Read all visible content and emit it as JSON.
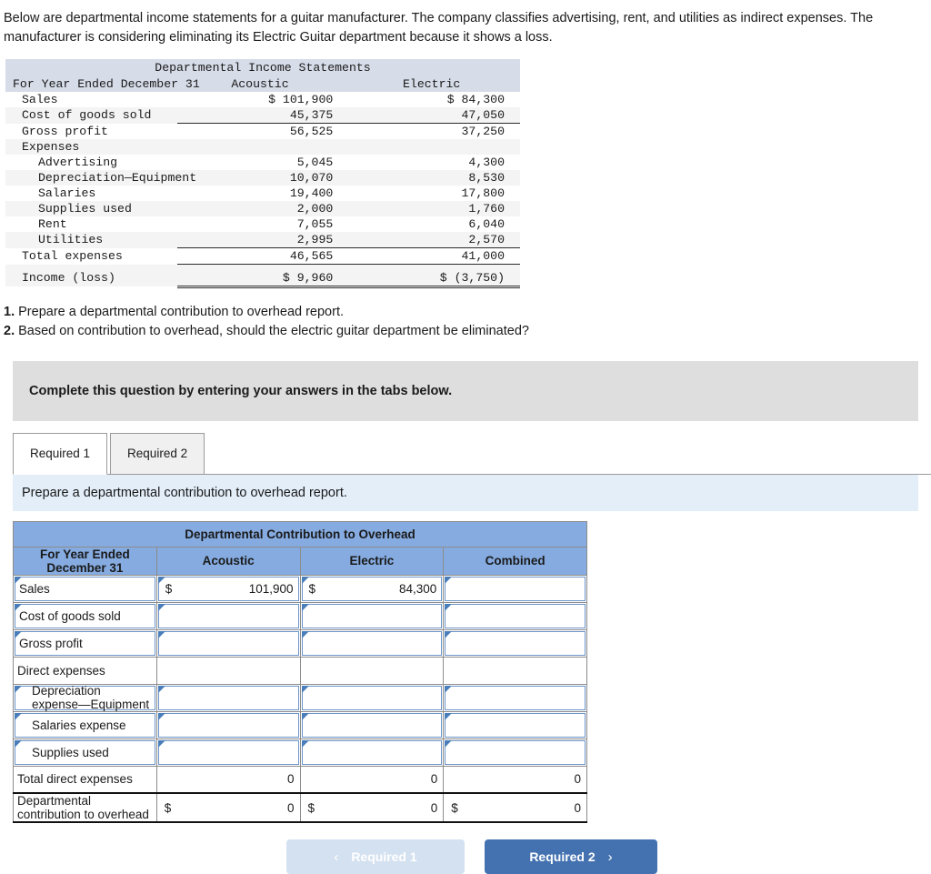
{
  "intro": "Below are departmental income statements for a guitar manufacturer. The company classifies advertising, rent, and utilities as indirect expenses. The manufacturer is considering eliminating its Electric Guitar department because it shows a loss.",
  "income_statement": {
    "title": "Departmental Income Statements",
    "period_label": "For Year Ended December 31",
    "columns": [
      "Acoustic",
      "Electric"
    ],
    "rows": [
      {
        "label": "Sales",
        "acoustic": "$ 101,900",
        "electric": "$ 84,300"
      },
      {
        "label": "Cost of goods sold",
        "acoustic": "45,375",
        "electric": "47,050"
      },
      {
        "label": "Gross profit",
        "acoustic": "56,525",
        "electric": "37,250"
      },
      {
        "label": "Expenses",
        "acoustic": "",
        "electric": ""
      },
      {
        "label": "Advertising",
        "acoustic": "5,045",
        "electric": "4,300"
      },
      {
        "label": "Depreciation—Equipment",
        "acoustic": "10,070",
        "electric": "8,530"
      },
      {
        "label": "Salaries",
        "acoustic": "19,400",
        "electric": "17,800"
      },
      {
        "label": "Supplies used",
        "acoustic": "2,000",
        "electric": "1,760"
      },
      {
        "label": "Rent",
        "acoustic": "7,055",
        "electric": "6,040"
      },
      {
        "label": "Utilities",
        "acoustic": "2,995",
        "electric": "2,570"
      },
      {
        "label": "Total expenses",
        "acoustic": "46,565",
        "electric": "41,000"
      },
      {
        "label": "Income (loss)",
        "acoustic": "$ 9,960",
        "electric": "$ (3,750)"
      }
    ]
  },
  "requirements": [
    {
      "num": "1.",
      "text": "Prepare a departmental contribution to overhead report."
    },
    {
      "num": "2.",
      "text": "Based on contribution to overhead, should the electric guitar department be eliminated?"
    }
  ],
  "banner": {
    "text": "Complete this question by entering your answers in the tabs below."
  },
  "tabs": [
    {
      "label": "Required 1",
      "active": true
    },
    {
      "label": "Required 2",
      "active": false
    }
  ],
  "sub_instruction": "Prepare a departmental contribution to overhead report.",
  "answer_table": {
    "title": "Departmental Contribution to Overhead",
    "headers": [
      "For Year Ended December 31",
      "Acoustic",
      "Electric",
      "Combined"
    ],
    "rows": [
      {
        "label": "Sales",
        "acoustic_currency": "$",
        "acoustic": "101,900",
        "electric_currency": "$",
        "electric": "84,300",
        "combined_currency": "",
        "combined": ""
      },
      {
        "label": "Cost of goods sold",
        "acoustic_currency": "",
        "acoustic": "",
        "electric_currency": "",
        "electric": "",
        "combined_currency": "",
        "combined": ""
      },
      {
        "label": "Gross profit",
        "acoustic_currency": "",
        "acoustic": "",
        "electric_currency": "",
        "electric": "",
        "combined_currency": "",
        "combined": ""
      },
      {
        "label": "Direct expenses",
        "acoustic_currency": "",
        "acoustic": "",
        "electric_currency": "",
        "electric": "",
        "combined_currency": "",
        "combined": ""
      },
      {
        "label": "Depreciation expense—Equipment",
        "acoustic_currency": "",
        "acoustic": "",
        "electric_currency": "",
        "electric": "",
        "combined_currency": "",
        "combined": ""
      },
      {
        "label": "Salaries expense",
        "acoustic_currency": "",
        "acoustic": "",
        "electric_currency": "",
        "electric": "",
        "combined_currency": "",
        "combined": ""
      },
      {
        "label": "Supplies used",
        "acoustic_currency": "",
        "acoustic": "",
        "electric_currency": "",
        "electric": "",
        "combined_currency": "",
        "combined": ""
      },
      {
        "label": "Total direct expenses",
        "acoustic_currency": "",
        "acoustic": "0",
        "electric_currency": "",
        "electric": "0",
        "combined_currency": "",
        "combined": "0"
      },
      {
        "label": "Departmental contribution to overhead",
        "acoustic_currency": "$",
        "acoustic": "0",
        "electric_currency": "$",
        "electric": "0",
        "combined_currency": "$",
        "combined": "0"
      }
    ]
  },
  "nav": {
    "prev_label": "Required 1",
    "prev_chevron": "‹",
    "next_label": "Required 2",
    "next_chevron": "›"
  },
  "colors": {
    "header_blue": "#85abe0",
    "instruction_blue": "#e3eef9",
    "banner_grey": "#dedede",
    "next_button": "#4472b0",
    "prev_button": "#d4e1f0",
    "cell_border_blue": "#6c94c8"
  }
}
